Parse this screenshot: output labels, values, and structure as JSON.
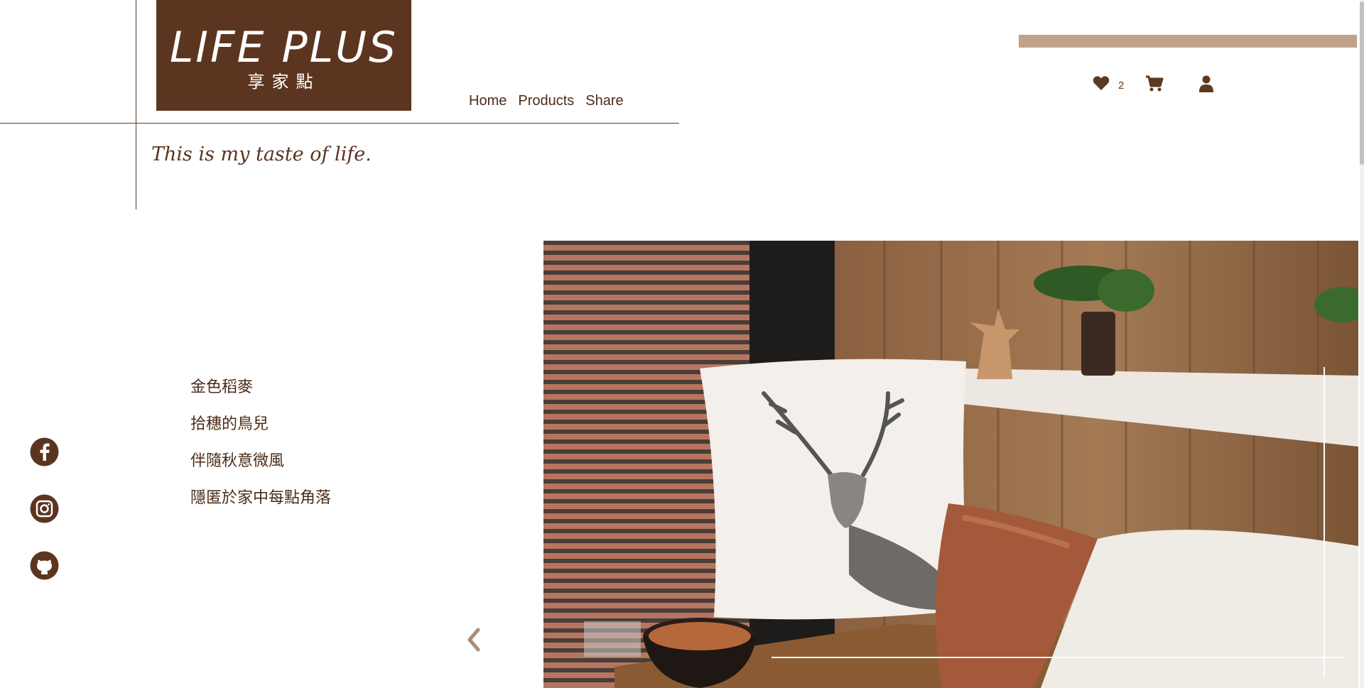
{
  "brand": {
    "logo_en": "LIFE PLUS",
    "logo_zh": "享家點",
    "tagline": "This is my taste of life."
  },
  "nav": {
    "home": "Home",
    "products": "Products",
    "share": "Share"
  },
  "toolbar": {
    "wishlist_count": "2",
    "icons": [
      "heart-icon",
      "cart-icon",
      "user-icon"
    ]
  },
  "social": [
    "facebook-icon",
    "instagram-icon",
    "github-icon"
  ],
  "poem": {
    "line1": "金色稻麥",
    "line2": "拾穗的鳥兒",
    "line3": "伴隨秋意微風",
    "line4": "隱匿於家中每點角落"
  },
  "colors": {
    "brand_brown": "#5c3520",
    "accent_tan": "#bfa28c",
    "text_brown": "#4b2c1a"
  }
}
